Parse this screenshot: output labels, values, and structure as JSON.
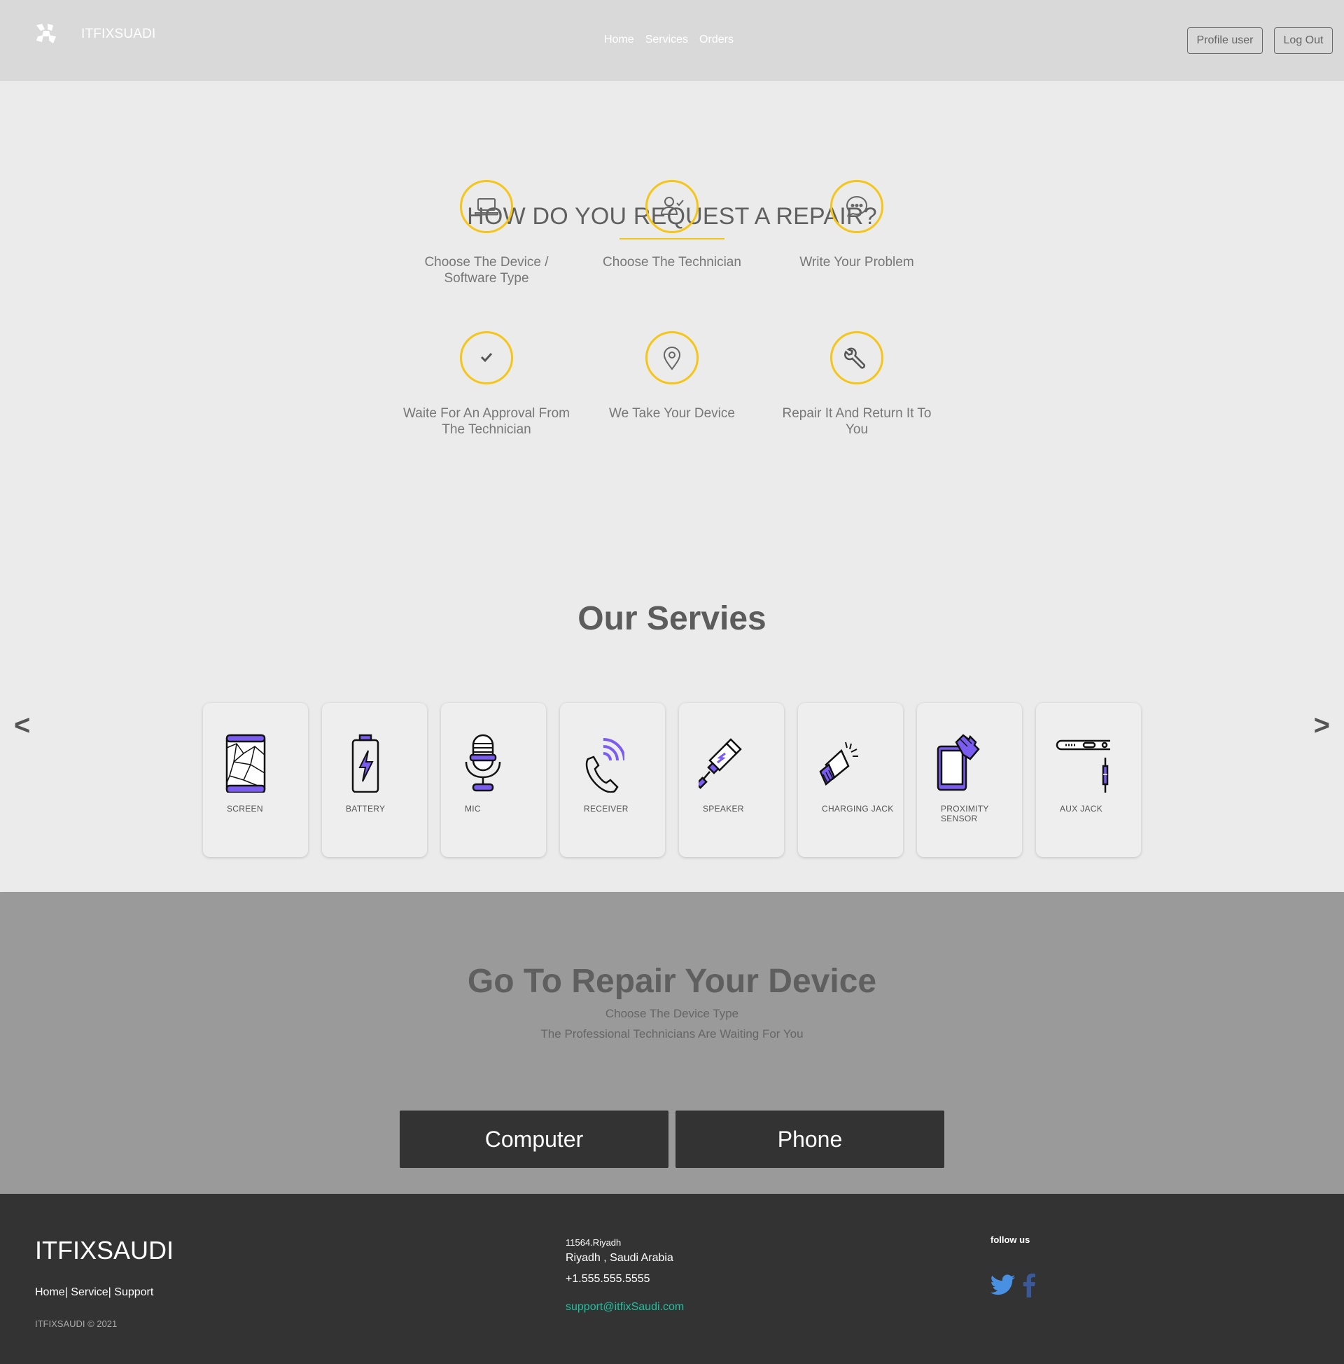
{
  "nav": {
    "brand": "ITFIXSUADI",
    "links": [
      "Home",
      "Services",
      "Orders"
    ],
    "profile_label": "Profile user",
    "logout_label": "Log Out"
  },
  "how": {
    "title": "HOW DO YOU REQUEST A REPAIR?",
    "steps": [
      {
        "icon": "laptop-icon",
        "label": "Choose The Device / Software Type"
      },
      {
        "icon": "user-check-icon",
        "label": "Choose The Technician"
      },
      {
        "icon": "chat-bubble-icon",
        "label": "Write Your Problem"
      },
      {
        "icon": "checkmark-icon",
        "label": "Waite For An Approval From The Technician"
      },
      {
        "icon": "map-pin-icon",
        "label": "We Take Your Device"
      },
      {
        "icon": "wrench-icon",
        "label": "Repair It And Return It To You"
      }
    ],
    "accent": "#f5c518"
  },
  "services": {
    "title": "Our Servies",
    "prev": "<",
    "next": ">",
    "items": [
      {
        "icon": "cracked-screen-icon",
        "label": "SCREEN"
      },
      {
        "icon": "battery-icon",
        "label": "BATTERY"
      },
      {
        "icon": "microphone-icon",
        "label": "MIC"
      },
      {
        "icon": "phone-receiver-icon",
        "label": "RECEIVER"
      },
      {
        "icon": "usb-cable-icon",
        "label": "SPEAKER"
      },
      {
        "icon": "megaphone-icon",
        "label": "CHARGING JACK"
      },
      {
        "icon": "hand-phone-icon",
        "label": "PROXIMITY SENSOR"
      },
      {
        "icon": "aux-jack-icon",
        "label": "AUX JACK"
      }
    ],
    "icon_color": "#7b5cf0"
  },
  "repair": {
    "title": "Go To Repair Your Device",
    "sub1": "Choose The Device Type",
    "sub2": "The Professional Technicians Are Waiting For You",
    "computer_label": "Computer",
    "phone_label": "Phone"
  },
  "footer": {
    "brand": "ITFIXSAUDI",
    "links": [
      "Home",
      "Service",
      "Support"
    ],
    "copyright": "ITFIXSAUDI © 2021",
    "addr1": "11564.Riyadh",
    "addr2": "Riyadh , Saudi Arabia",
    "phone": "+1.555.555.5555",
    "email": "support@itfixSaudi.com",
    "follow": "follow us"
  }
}
